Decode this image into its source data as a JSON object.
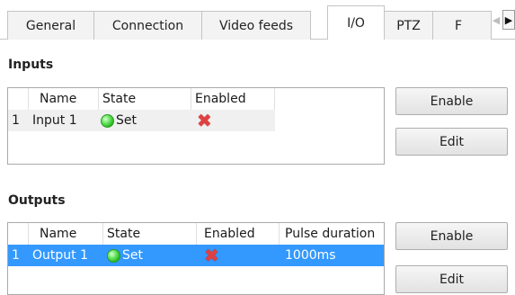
{
  "tabs": [
    {
      "label": "General",
      "active": false
    },
    {
      "label": "Connection",
      "active": false
    },
    {
      "label": "Video feeds",
      "active": false
    },
    {
      "label": "I/O",
      "active": true
    },
    {
      "label": "PTZ",
      "active": false
    },
    {
      "label": "F",
      "active": false
    }
  ],
  "tab_scroll": {
    "left_icon": "scroll-left-arrow",
    "right_icon": "scroll-right-arrow"
  },
  "inputs": {
    "title": "Inputs",
    "columns": [
      "",
      "Name",
      "State",
      "Enabled"
    ],
    "rows": [
      {
        "index": "1",
        "name": "Input 1",
        "state": "Set",
        "state_icon": "green-dot",
        "enabled_icon": "red-x",
        "selected": false
      }
    ],
    "enable_button": "Enable",
    "edit_button": "Edit"
  },
  "outputs": {
    "title": "Outputs",
    "columns": [
      "",
      "Name",
      "State",
      "Enabled",
      "Pulse duration"
    ],
    "rows": [
      {
        "index": "1",
        "name": "Output 1",
        "state": "Set",
        "state_icon": "green-dot",
        "enabled_icon": "red-x",
        "pulse_duration": "1000ms",
        "selected": true
      }
    ],
    "enable_button": "Enable",
    "edit_button": "Edit"
  },
  "colors": {
    "selection": "#3399ff",
    "state_ok": "#2ecc40",
    "disabled": "#e04040"
  }
}
